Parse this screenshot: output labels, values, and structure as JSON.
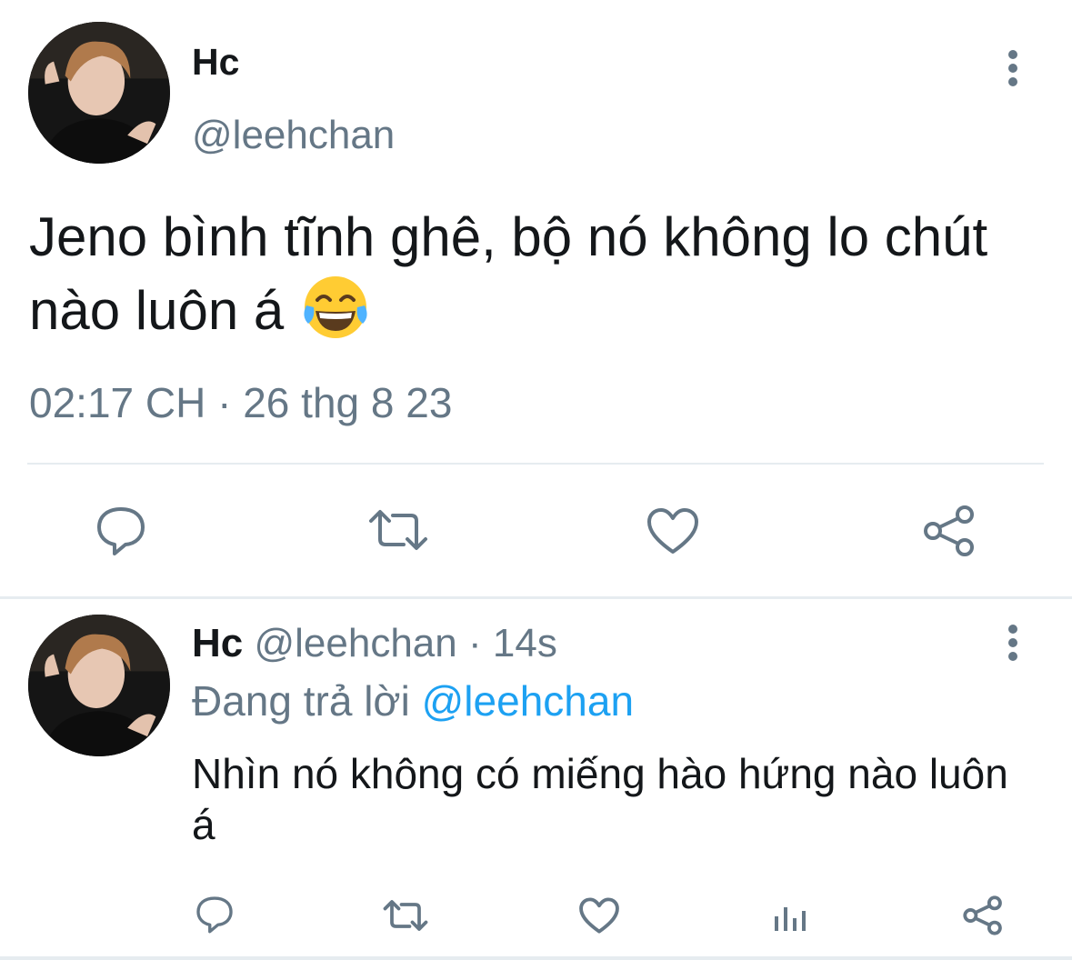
{
  "main_tweet": {
    "author_name": "Hc",
    "author_handle": "@leehchan",
    "text": "Jeno bình tĩnh ghê, bộ nó không lo chút nào luôn á",
    "emoji": "face-with-tears-of-joy",
    "timestamp": "02:17 CH · 26 thg 8 23",
    "actions": [
      "reply-icon",
      "retweet-icon",
      "like-icon",
      "share-icon"
    ]
  },
  "reply_tweet": {
    "author_name": "Hc",
    "author_handle": "@leehchan",
    "separator": "·",
    "age": "14s",
    "replying_to_label": "Đang trả lời",
    "replying_to_handle": "@leehchan",
    "text": "Nhìn nó không có miếng hào hứng nào luôn á",
    "actions": [
      "reply-icon",
      "retweet-icon",
      "like-icon",
      "analytics-icon",
      "share-icon"
    ]
  },
  "colors": {
    "text_primary": "#14171a",
    "text_secondary": "#657786",
    "link": "#1da1f2",
    "divider": "#e6ecf0",
    "icon": "#657786"
  }
}
